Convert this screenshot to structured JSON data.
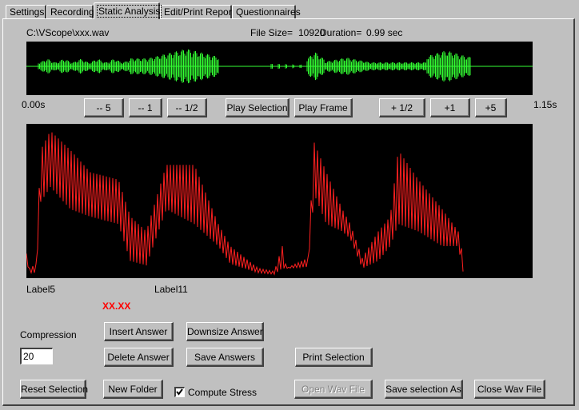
{
  "tabs": [
    {
      "label": "Settings",
      "active": false
    },
    {
      "label": "Recording",
      "active": false
    },
    {
      "label": "Static Analysis",
      "active": true
    },
    {
      "label": "Edit/Print Report",
      "active": false
    },
    {
      "label": "Questionnaires",
      "active": false
    }
  ],
  "file": {
    "path": "C:\\VScope\\xxx.wav",
    "size_label": "File Size=",
    "size_value": "10920",
    "duration_label": "Duration=",
    "duration_value": "0.99 sec"
  },
  "waveform": {
    "color": "#33ff33",
    "time_start": "0.00s",
    "time_end": "1.15s"
  },
  "nav_buttons": {
    "minus5": "-- 5",
    "minus1": "-- 1",
    "minus_half": "-- 1/2",
    "play_selection": "Play Selection",
    "play_frame": "Play Frame",
    "plus_half": "+ 1/2",
    "plus1": "+1",
    "plus5": "+5"
  },
  "pitch_plot": {
    "color": "#ff2020",
    "label_left": "Label5",
    "label_mid": "Label11",
    "value": "XX.XX",
    "value_color": "#ff0000"
  },
  "compression": {
    "label": "Compression",
    "value": "20"
  },
  "answer_buttons": {
    "insert": "Insert Answer",
    "downsize": "Downsize Answer",
    "delete": "Delete Answer",
    "save": "Save Answers",
    "print_selection": "Print Selection"
  },
  "bottom_buttons": {
    "reset_selection": "Reset Selection",
    "new_folder": "New Folder",
    "open_wav": "Open Wav File",
    "save_selection_as": "Save selection As",
    "close_wav": "Close Wav File"
  },
  "compute_stress": {
    "label": "Compute Stress",
    "checked": true
  }
}
